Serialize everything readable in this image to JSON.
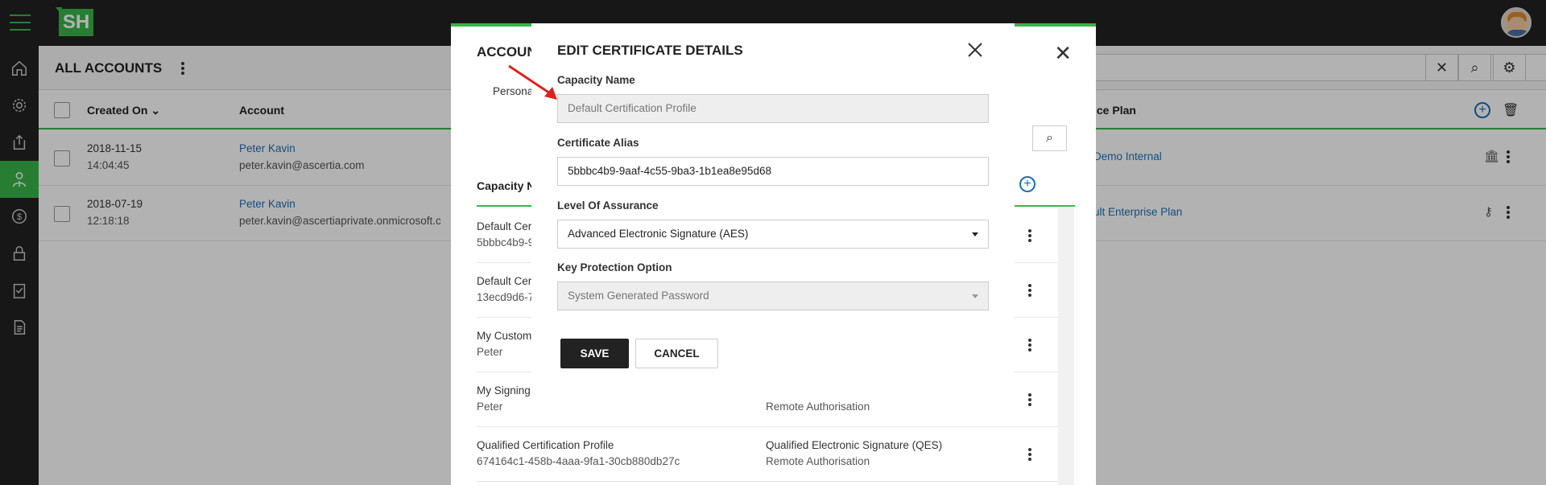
{
  "app": {
    "logo": "SH",
    "accent": "#39b54a"
  },
  "nav": {
    "items": [
      "home-icon",
      "gear-icon",
      "upload-icon",
      "user-tie-icon",
      "dollar-icon",
      "lock-icon",
      "clipboard-check-icon",
      "document-icon"
    ],
    "active": "user-tie-icon"
  },
  "page": {
    "title": "ALL ACCOUNTS",
    "columns": {
      "created_on": "Created On",
      "account": "Account",
      "service_plan": "ice Plan"
    },
    "rows": [
      {
        "date": "2018-11-15",
        "time": "14:04:45",
        "name": "Peter Kavin",
        "email": "peter.kavin@ascertia.com",
        "plan": "Demo Internal"
      },
      {
        "date": "2018-07-19",
        "time": "12:18:18",
        "name": "Peter Kavin",
        "email": "peter.kavin@ascertiaprivate.onmicrosoft.c",
        "plan": "ult Enterprise Plan"
      }
    ]
  },
  "dialog": {
    "title": "ACCOUN",
    "tab": "Persona",
    "column": "Capacity N",
    "rows": [
      {
        "name": "Default Cer",
        "sub": "5bbbc4b9-9",
        "col2": "",
        "col3": ""
      },
      {
        "name": "Default Cer",
        "sub": "13ecd9d6-7",
        "col2": "",
        "col3": ""
      },
      {
        "name": "My Custom",
        "sub": "Peter",
        "col2": "",
        "col3": ""
      },
      {
        "name": "My Signing",
        "sub": "Peter",
        "col2": "",
        "col3": "Remote Authorisation"
      },
      {
        "name": "Qualified Certification Profile",
        "sub": "674164c1-458b-4aaa-9fa1-30cb880db27c",
        "col2": "Qualified Electronic Signature (QES)",
        "col3": "Remote Authorisation"
      }
    ]
  },
  "modal": {
    "title": "EDIT CERTIFICATE DETAILS",
    "capacity_name_label": "Capacity Name",
    "capacity_name_value": "Default Certification Profile",
    "alias_label": "Certificate Alias",
    "alias_value": "5bbbc4b9-9aaf-4c55-9ba3-1b1ea8e95d68",
    "loa_label": "Level Of Assurance",
    "loa_value": "Advanced Electronic Signature (AES)",
    "kpo_label": "Key Protection Option",
    "kpo_value": "System Generated Password",
    "save": "SAVE",
    "cancel": "CANCEL"
  }
}
